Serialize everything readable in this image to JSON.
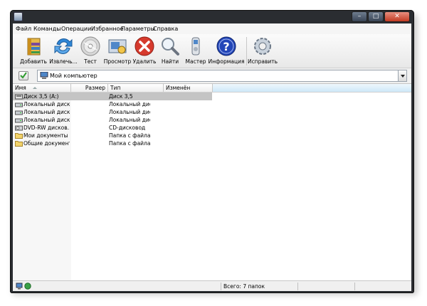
{
  "menu": {
    "items": [
      {
        "label": "Файл"
      },
      {
        "label": "Команды"
      },
      {
        "label": "Операции"
      },
      {
        "label": "Избранное"
      },
      {
        "label": "Параметры"
      },
      {
        "label": "Справка"
      }
    ]
  },
  "toolbar": {
    "buttons": [
      {
        "label": "Добавить",
        "icon": "add-archive-icon"
      },
      {
        "label": "Извлечь...",
        "icon": "extract-icon"
      },
      {
        "label": "Тест",
        "icon": "test-disc-icon"
      },
      {
        "label": "Просмотр",
        "icon": "view-icon"
      },
      {
        "label": "Удалить",
        "icon": "delete-icon"
      },
      {
        "label": "Найти",
        "icon": "find-icon"
      },
      {
        "label": "Мастер",
        "icon": "wizard-icon"
      },
      {
        "label": "Информация",
        "icon": "info-icon"
      },
      {
        "label": "Исправить",
        "icon": "repair-icon"
      }
    ]
  },
  "address": {
    "value": "Мой компьютер"
  },
  "columns": [
    {
      "label": "Имя"
    },
    {
      "label": "Размер"
    },
    {
      "label": "Тип"
    },
    {
      "label": "Изменён"
    }
  ],
  "files": [
    {
      "name": "Диск 3,5 (A:)",
      "type": "Диск 3,5",
      "icon": "floppy-icon",
      "selected": true
    },
    {
      "name": "Локальный диск...",
      "type": "Локальный диск",
      "icon": "local-disk-icon"
    },
    {
      "name": "Локальный диск...",
      "type": "Локальный диск",
      "icon": "local-disk-icon"
    },
    {
      "name": "Локальный диск...",
      "type": "Локальный диск",
      "icon": "local-disk-icon"
    },
    {
      "name": "DVD-RW дисков...",
      "type": "CD-дисковод",
      "icon": "dvd-drive-icon"
    },
    {
      "name": "Мои документы",
      "type": "Папка с файлами",
      "icon": "folder-icon"
    },
    {
      "name": "Общие документы",
      "type": "Папка с файлами",
      "icon": "folder-icon"
    }
  ],
  "status": {
    "text": "Всего: 7 папок"
  },
  "colors": {
    "frame": "#2a2d31",
    "selection": "#c4c4c4",
    "header_highlight": "#cde8f8"
  }
}
